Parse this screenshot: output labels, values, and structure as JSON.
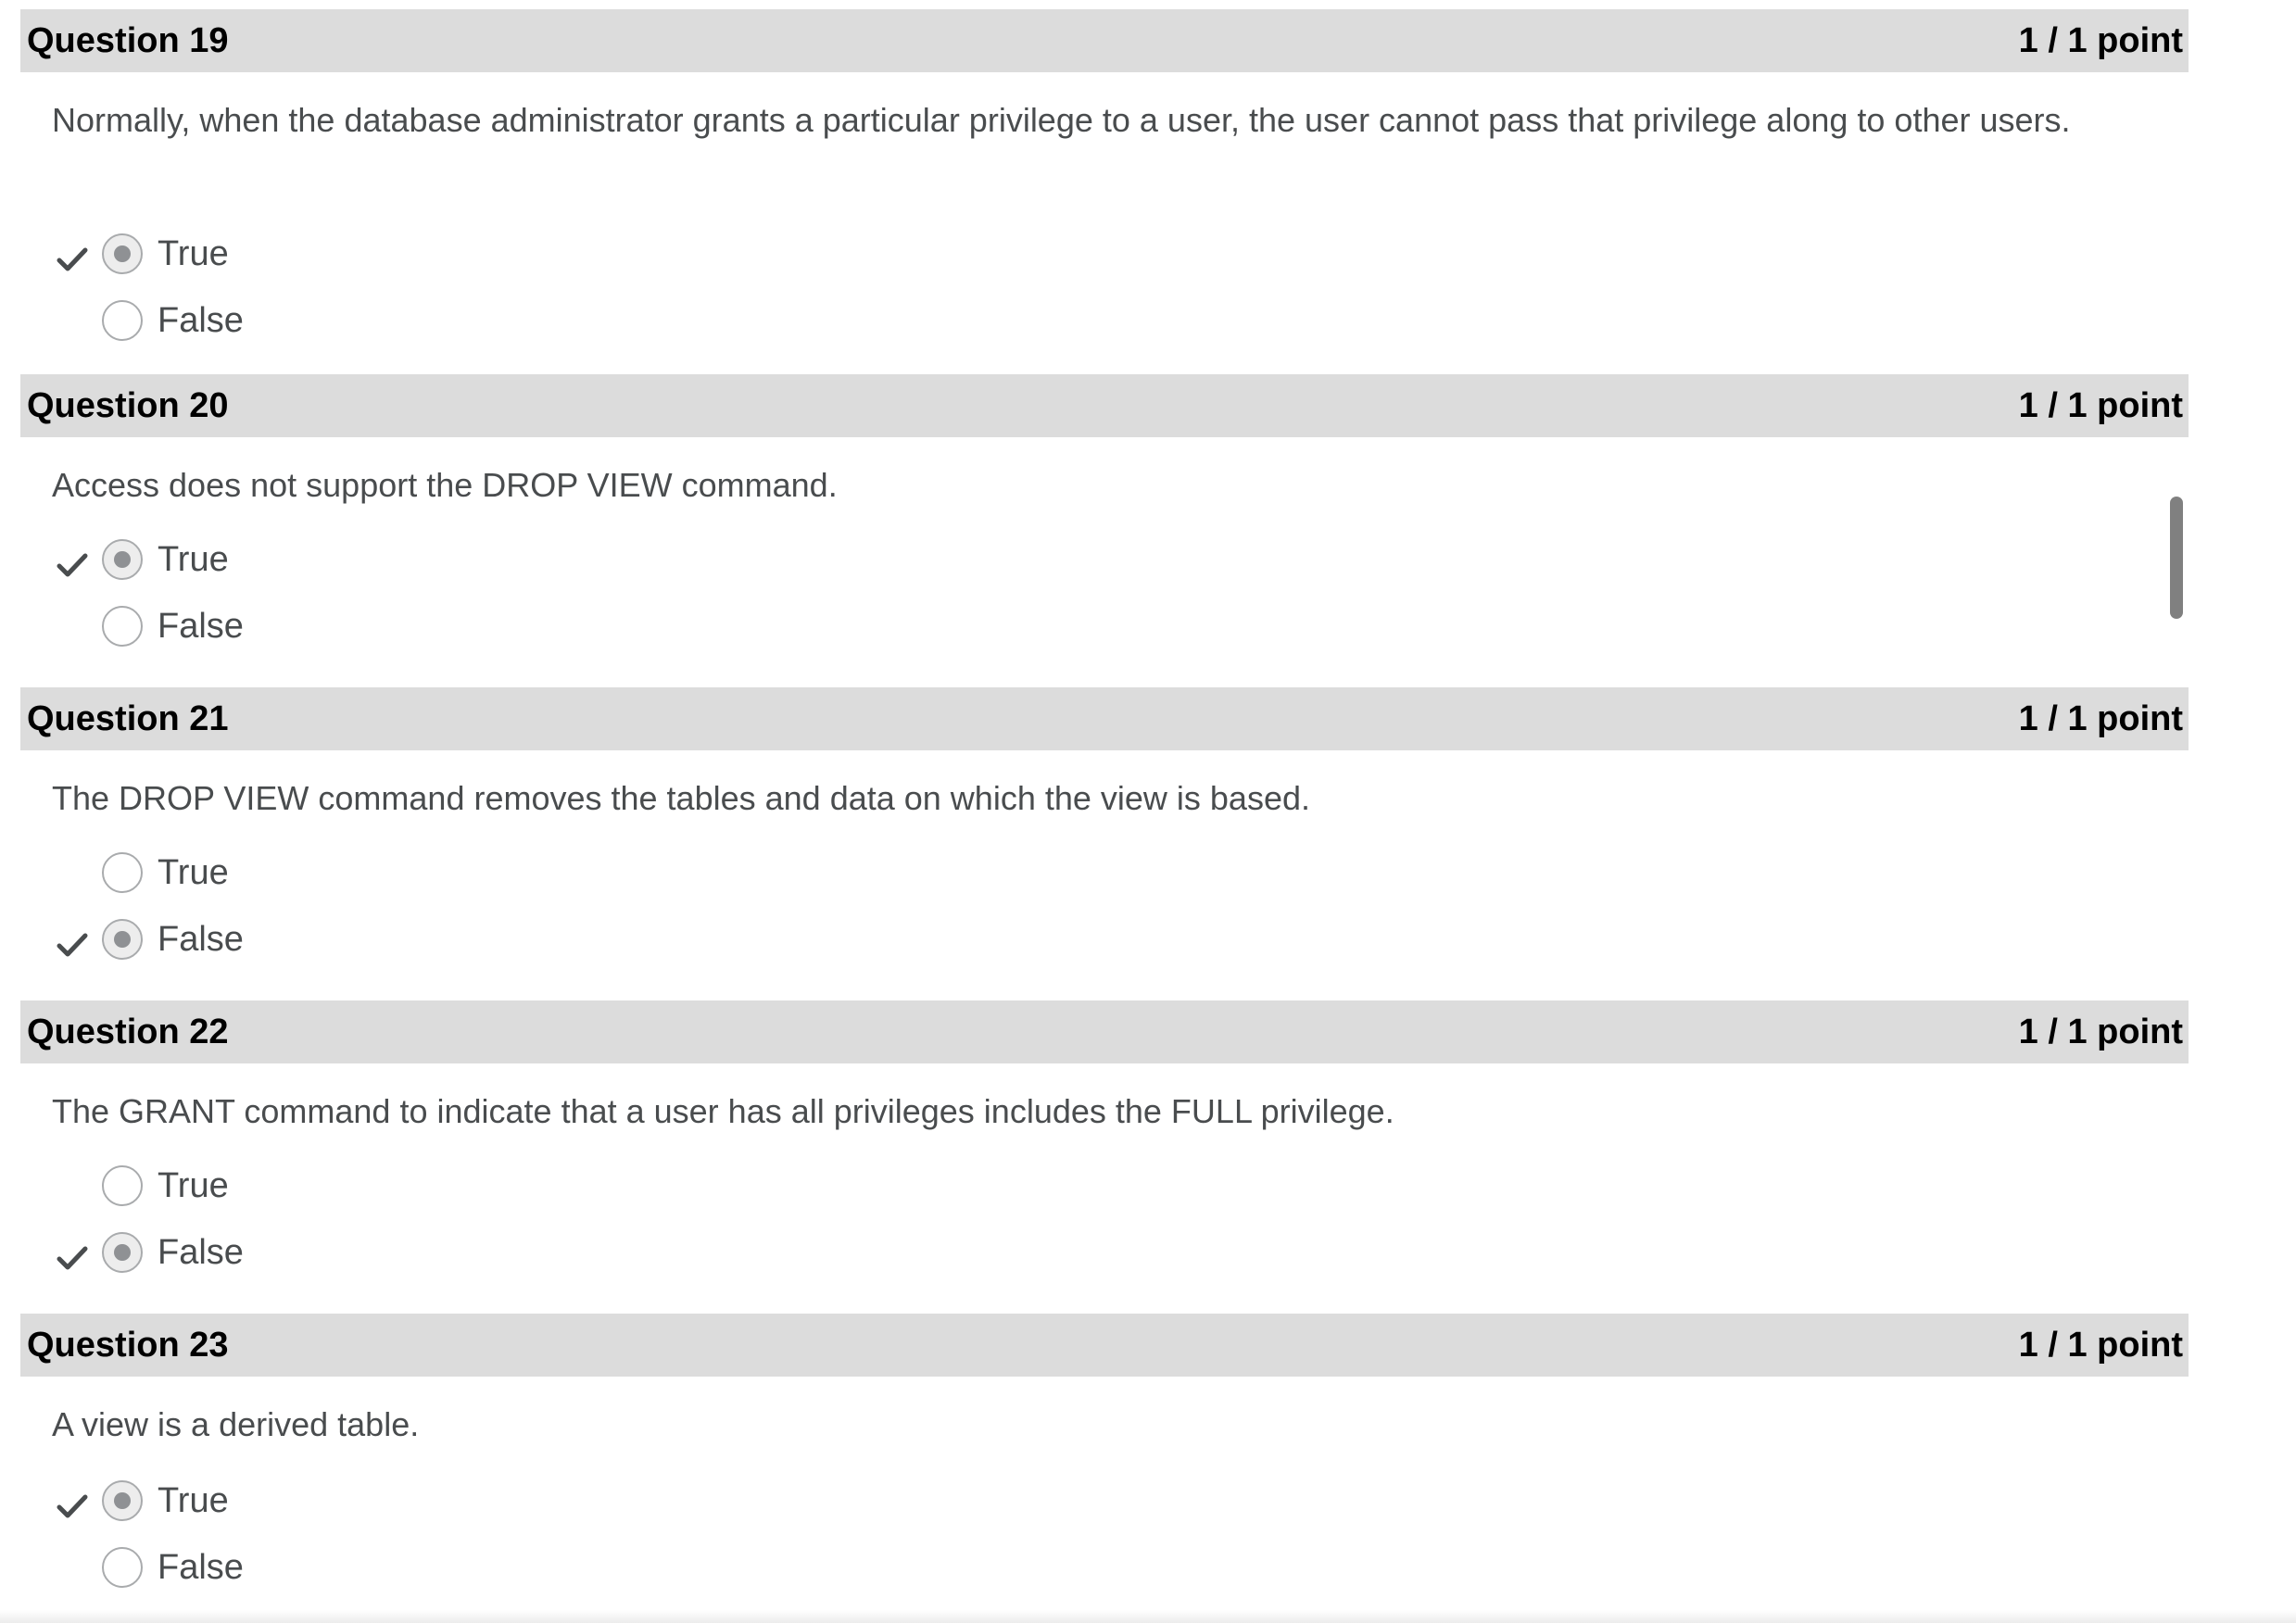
{
  "questions": [
    {
      "title": "Question 19",
      "score": "1 / 1 point",
      "text": "Normally, when the database administrator grants a particular privilege to a user, the user cannot pass that privilege along to other users.",
      "options": [
        {
          "label": "True",
          "selected": true,
          "correct": true
        },
        {
          "label": "False",
          "selected": false,
          "correct": false
        }
      ]
    },
    {
      "title": "Question 20",
      "score": "1 / 1 point",
      "text": "Access does not support the DROP VIEW command.",
      "options": [
        {
          "label": "True",
          "selected": true,
          "correct": true
        },
        {
          "label": "False",
          "selected": false,
          "correct": false
        }
      ]
    },
    {
      "title": "Question 21",
      "score": "1 / 1 point",
      "text": "The DROP VIEW command removes the tables and data on which the view is based.",
      "options": [
        {
          "label": "True",
          "selected": false,
          "correct": false
        },
        {
          "label": "False",
          "selected": true,
          "correct": true
        }
      ]
    },
    {
      "title": "Question 22",
      "score": "1 / 1 point",
      "text": "The GRANT command to indicate that a user has all privileges includes the FULL privilege.",
      "options": [
        {
          "label": "True",
          "selected": false,
          "correct": false
        },
        {
          "label": "False",
          "selected": true,
          "correct": true
        }
      ]
    },
    {
      "title": "Question 23",
      "score": "1 / 1 point",
      "text": "A view is a derived table.",
      "options": [
        {
          "label": "True",
          "selected": true,
          "correct": true
        },
        {
          "label": "False",
          "selected": false,
          "correct": false
        }
      ]
    }
  ],
  "icons": {
    "correct": "checkmark-icon"
  },
  "colors": {
    "header_bg": "#dcdcdc",
    "text": "#494c4e",
    "radio_dot": "#8f9194"
  }
}
